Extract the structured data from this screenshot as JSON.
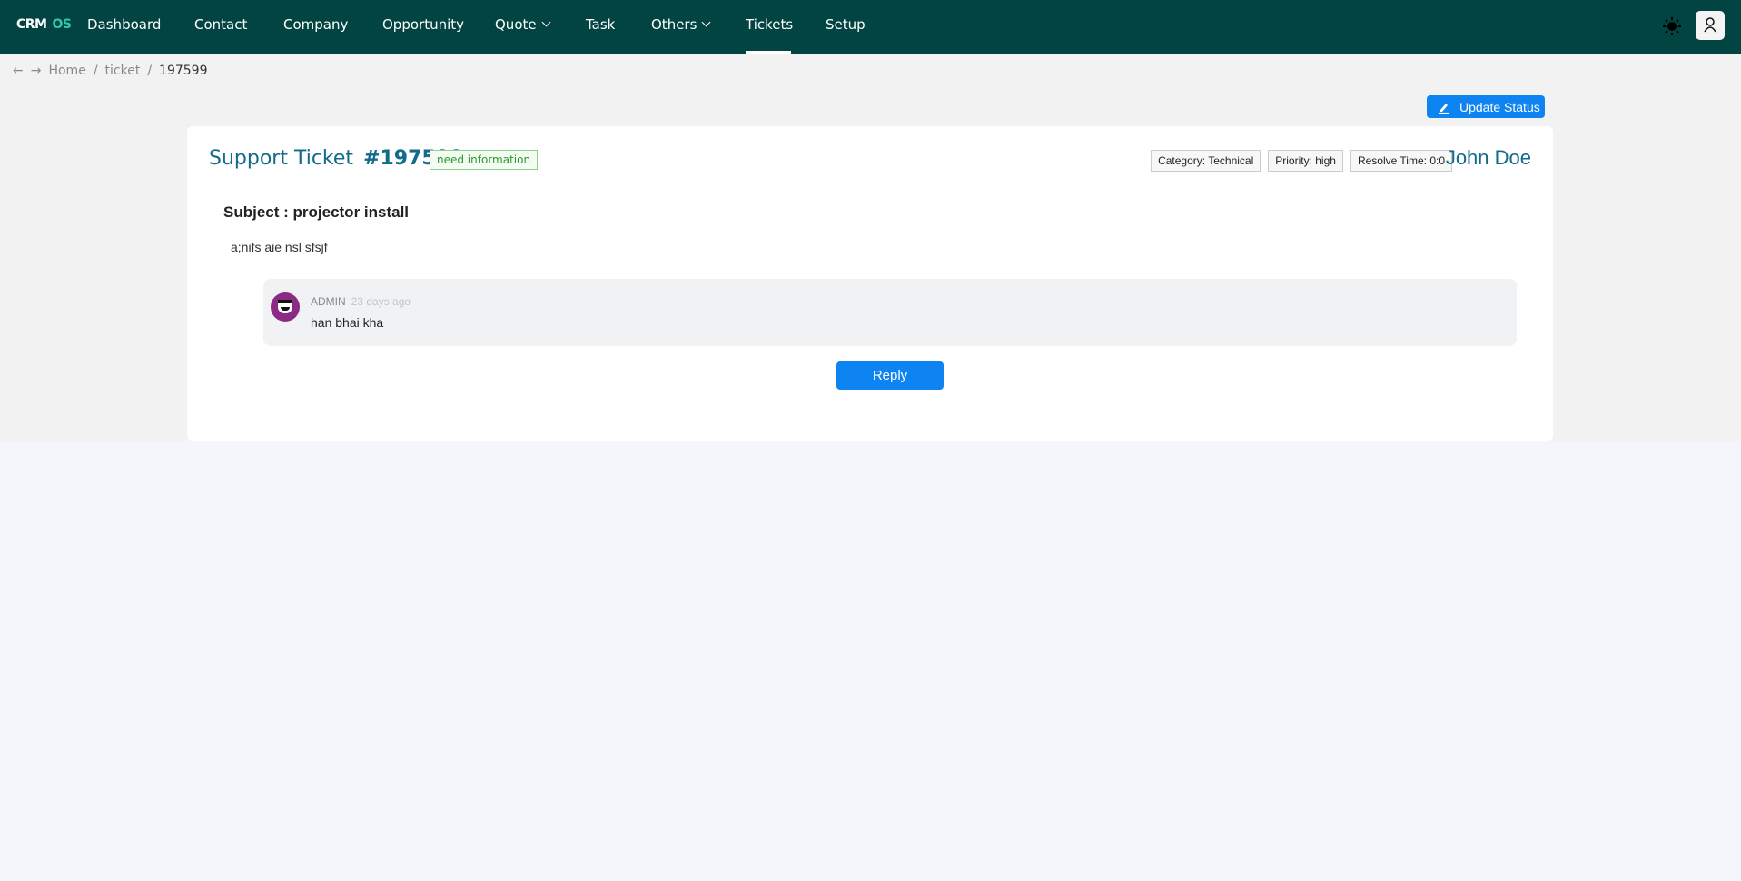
{
  "nav": {
    "logo_crm": "CRM",
    "logo_os": "OS",
    "items": [
      {
        "label": "Dashboard"
      },
      {
        "label": "Contact"
      },
      {
        "label": "Company"
      },
      {
        "label": "Opportunity"
      },
      {
        "label": "Quote"
      },
      {
        "label": "Task"
      },
      {
        "label": "Others"
      },
      {
        "label": "Tickets"
      },
      {
        "label": "Setup"
      }
    ],
    "active": "Tickets"
  },
  "breadcrumb": [
    "Home",
    "ticket",
    "197599"
  ],
  "actions": {
    "update_status": "Update Status"
  },
  "ticket": {
    "title": "Support Ticket",
    "number": "#197599",
    "status": "need information",
    "category": "Category: Technical",
    "priority": "Priority: high",
    "resolve_time": "Resolve Time: 0:0",
    "owner": "John Doe",
    "subject": "Subject : projector install",
    "body": "a;nifs aie nsl sfsjf"
  },
  "comments": [
    {
      "author": "ADMIN",
      "time": "23 days ago",
      "text": "han bhai kha"
    }
  ],
  "reply_label": "Reply",
  "colors": {
    "nav": "#024442",
    "accent": "#0d84f2",
    "title": "#136b8a"
  }
}
